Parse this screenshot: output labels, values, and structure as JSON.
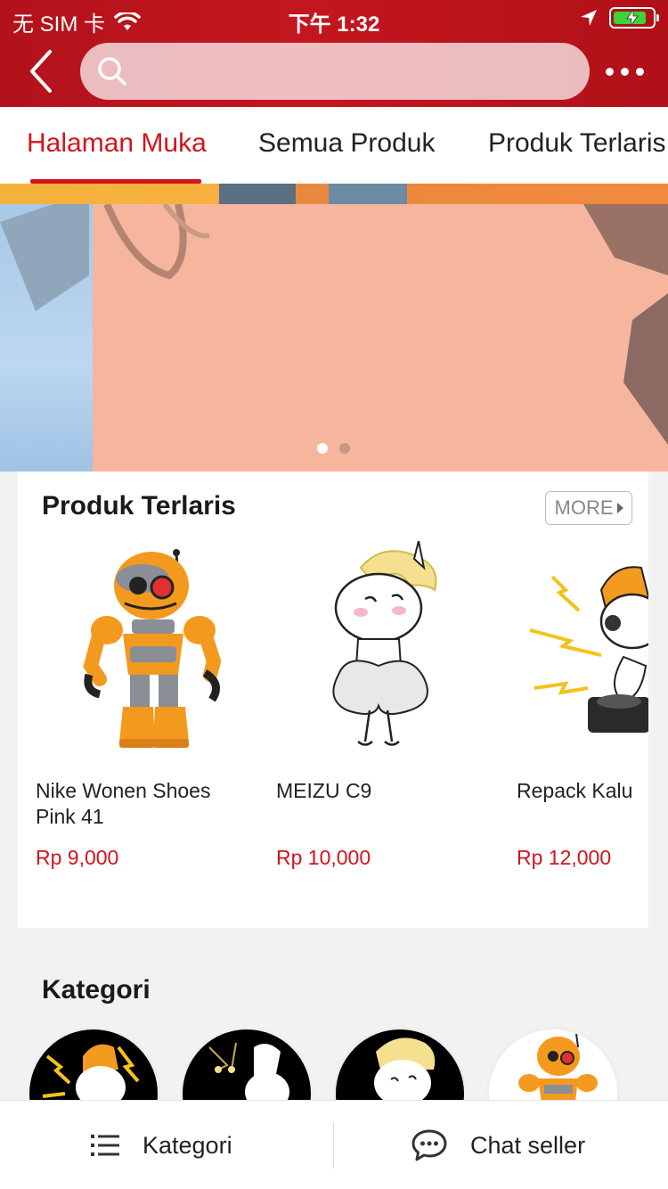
{
  "status_bar": {
    "carrier": "无 SIM 卡",
    "time": "下午 1:32"
  },
  "header": {
    "search_placeholder": ""
  },
  "tabs": [
    {
      "label": "Halaman Muka",
      "active": true
    },
    {
      "label": "Semua Produk",
      "active": false
    },
    {
      "label": "Produk Terlaris",
      "active": false
    }
  ],
  "banner": {
    "page_count": 2,
    "active_index": 0
  },
  "bestsellers": {
    "title": "Produk Terlaris",
    "more_label": "MORE",
    "items": [
      {
        "name": "Nike Wonen Shoes Pink 41",
        "price": "Rp 9,000",
        "image": "orange-robot-toy"
      },
      {
        "name": "MEIZU C9",
        "price": "Rp 10,000",
        "image": "unicorn-marilyn-sticker"
      },
      {
        "name": "Repack Kalu",
        "price": "Rp 12,000",
        "image": "unicorn-dj-sticker"
      }
    ]
  },
  "kategori": {
    "title": "Kategori",
    "items": [
      {
        "image": "unicorn-dj-sticker"
      },
      {
        "image": "unicorn-chandelier-sticker"
      },
      {
        "image": "unicorn-marilyn-sticker"
      },
      {
        "image": "orange-robot-toy"
      }
    ]
  },
  "bottom_bar": {
    "kategori_label": "Kategori",
    "chat_label": "Chat seller"
  },
  "colors": {
    "brand_red": "#c4161f",
    "price_red": "#d3141c"
  }
}
